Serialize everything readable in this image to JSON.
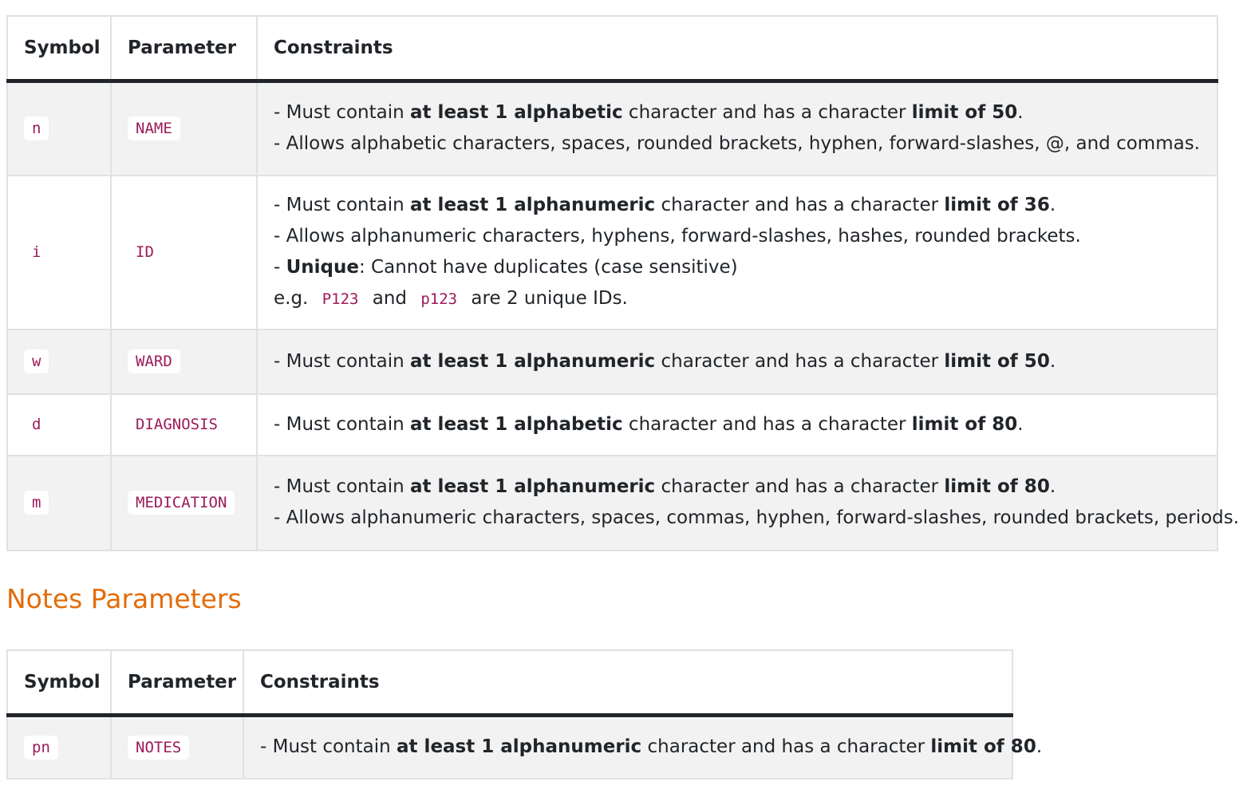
{
  "table1": {
    "headers": [
      "Symbol",
      "Parameter",
      "Constraints"
    ],
    "rows": [
      {
        "symbol": "n",
        "param": "NAME",
        "line1": {
          "pre": "- Must contain ",
          "b1": "at least 1 alphabetic",
          "mid": " character and has a character ",
          "b2": "limit of 50",
          "post": "."
        },
        "line2": "- Allows alphabetic characters, spaces, rounded brackets, hyphen, forward-slashes, @, and commas."
      },
      {
        "symbol": "i",
        "param": "ID",
        "line1": {
          "pre": "- Must contain ",
          "b1": "at least 1 alphanumeric",
          "mid": " character and has a character ",
          "b2": "limit of 36",
          "post": "."
        },
        "line2": "- Allows alphanumeric characters, hyphens, forward-slashes, hashes, rounded brackets.",
        "unique": {
          "dash": "- ",
          "bold": "Unique",
          "rest": ": Cannot have duplicates (case sensitive)"
        },
        "example": {
          "pre": "e.g. ",
          "code1": "P123",
          "and": " and ",
          "code2": "p123",
          "post": " are 2 unique IDs."
        }
      },
      {
        "symbol": "w",
        "param": "WARD",
        "line1": {
          "pre": "- Must contain ",
          "b1": "at least 1 alphanumeric",
          "mid": " character and has a character ",
          "b2": "limit of 50",
          "post": "."
        }
      },
      {
        "symbol": "d",
        "param": "DIAGNOSIS",
        "line1": {
          "pre": "- Must contain ",
          "b1": "at least 1 alphabetic",
          "mid": " character and has a character ",
          "b2": "limit of 80",
          "post": "."
        }
      },
      {
        "symbol": "m",
        "param": "MEDICATION",
        "line1": {
          "pre": "- Must contain ",
          "b1": "at least 1 alphanumeric",
          "mid": " character and has a character ",
          "b2": "limit of 80",
          "post": "."
        },
        "line2": "- Allows alphanumeric characters, spaces, commas, hyphen, forward-slashes, rounded brackets, periods."
      }
    ]
  },
  "section_title": "Notes Parameters",
  "table2": {
    "headers": [
      "Symbol",
      "Parameter",
      "Constraints"
    ],
    "rows": [
      {
        "symbol": "pn",
        "param": "NOTES",
        "line1": {
          "pre": "- Must contain ",
          "b1": "at least 1 alphanumeric",
          "mid": " character and has a character ",
          "b2": "limit of 80",
          "post": "."
        }
      }
    ]
  },
  "colors": {
    "heading": "#e36c0a",
    "code": "#9c1a5a",
    "stripe": "#f2f2f2",
    "border": "#dee2e6"
  }
}
